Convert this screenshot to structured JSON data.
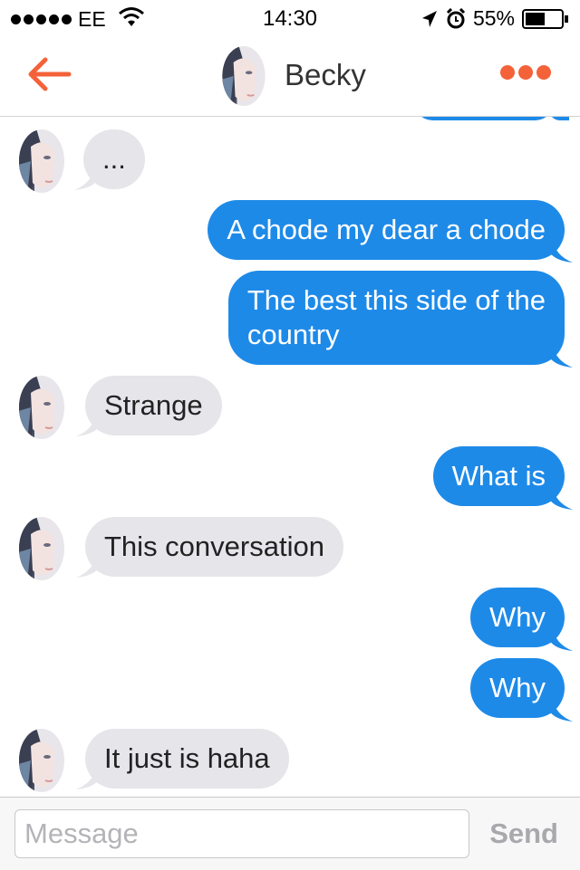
{
  "status_bar": {
    "carrier": "EE",
    "time": "14:30",
    "battery": "55%",
    "battery_level": 0.55,
    "signal_bars": 5
  },
  "header": {
    "contact_name": "Becky",
    "back_icon": "arrow-left",
    "more_icon": "three-dots",
    "accent_color": "#f4623a"
  },
  "colors": {
    "outgoing_bubble": "#1e8ae8",
    "incoming_bubble": "#e5e5ea"
  },
  "messages": [
    {
      "from": "contact",
      "text": "..."
    },
    {
      "from": "me",
      "text": "A chode my dear a chode"
    },
    {
      "from": "me",
      "text": "The best this side of the",
      "text2": "country"
    },
    {
      "from": "contact",
      "text": "Strange"
    },
    {
      "from": "me",
      "text": "What is"
    },
    {
      "from": "contact",
      "text": "This conversation"
    },
    {
      "from": "me",
      "text": "Why"
    },
    {
      "from": "me",
      "text": "Why"
    },
    {
      "from": "contact",
      "text": "It just is haha"
    }
  ],
  "composer": {
    "placeholder": "Message",
    "value": "",
    "send_label": "Send"
  }
}
